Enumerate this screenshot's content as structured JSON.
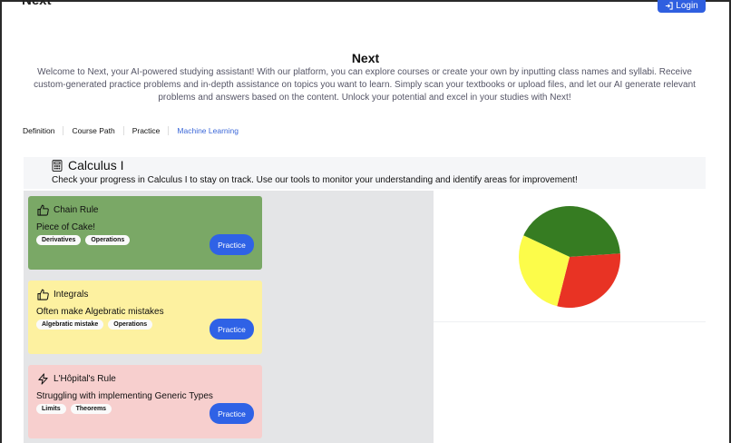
{
  "header": {
    "brand": "Next",
    "login_label": "Login"
  },
  "hero": {
    "title": "Next",
    "description": "Welcome to Next, your AI-powered studying assistant! With our platform, you can explore courses or create your own by inputting class names and syllabi. Receive custom-generated practice problems and in-depth assistance on topics you want to learn. Simply scan your textbooks or upload files, and let our AI generate relevant problems and answers based on the content. Unlock your potential and excel in your studies with Next!"
  },
  "tabs": [
    {
      "label": "Definition"
    },
    {
      "label": "Course Path"
    },
    {
      "label": "Practice"
    },
    {
      "label": "Machine Learning"
    }
  ],
  "colors": {
    "accent": "#2f62e6",
    "active_tab": "#3b67d8",
    "card_green": "#7aa866",
    "card_yellow": "#fdf1a0",
    "card_red": "#f7cfce"
  },
  "course": {
    "icon": "calculator-icon",
    "title": "Calculus I",
    "subtitle": "Check your progress in Calculus I to stay on track. Use our tools to monitor your understanding and identify areas for improvement!"
  },
  "topics": [
    {
      "title": "Chain Rule",
      "icon": "thumbs-up-icon",
      "status": "Piece of Cake!",
      "tags": [
        "Derivatives",
        "Operations"
      ],
      "button": "Practice"
    },
    {
      "title": "Integrals",
      "icon": "thumbs-up-icon",
      "status": "Often make Algebratic mistakes",
      "tags": [
        "Algebratic mistake",
        "Operations"
      ],
      "button": "Practice"
    },
    {
      "title": "L'Hôpital's Rule",
      "icon": "lightning-icon",
      "status": "Struggling with implementing Generic Types",
      "tags": [
        "Limits",
        "Theorems"
      ],
      "button": "Practice"
    }
  ],
  "chart_data": {
    "type": "pie",
    "values": [
      42,
      30,
      28
    ],
    "colors": [
      "#367c22",
      "#e83324",
      "#fcfc4a"
    ],
    "start_angle_deg": 205
  }
}
